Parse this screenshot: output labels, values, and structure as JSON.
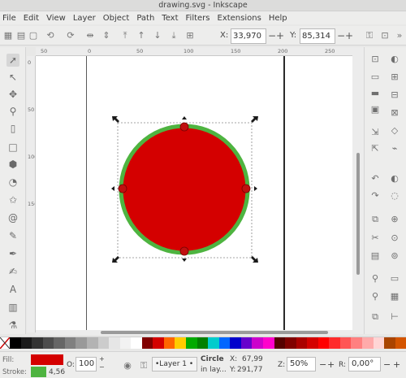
{
  "window": {
    "title": "drawing.svg - Inkscape"
  },
  "menu": [
    "File",
    "Edit",
    "View",
    "Layer",
    "Object",
    "Path",
    "Text",
    "Filters",
    "Extensions",
    "Help"
  ],
  "coords": {
    "x_label": "X:",
    "x_value": "33,970",
    "y_label": "Y:",
    "y_value": "85,314",
    "minus": "−",
    "plus": "+"
  },
  "ruler": {
    "h_ticks": [
      "50",
      "0",
      "50",
      "100",
      "150",
      "200",
      "250"
    ],
    "v_ticks": [
      "0",
      "50",
      "100",
      "150"
    ]
  },
  "tools": [
    "selector-tool",
    "node-tool",
    "tweak-tool",
    "zoom-tool",
    "measure-tool",
    "rectangle-tool",
    "box-tool",
    "ellipse-tool",
    "star-tool",
    "spiral-tool",
    "pencil-tool",
    "pen-tool",
    "calligraphy-tool",
    "text-tool",
    "gradient-tool",
    "dropper-tool"
  ],
  "colors": {
    "fill": "#d40000",
    "stroke": "#4eb440",
    "node": "#c01010",
    "palette": [
      "#000000",
      "#1a1a1a",
      "#333333",
      "#4d4d4d",
      "#666666",
      "#808080",
      "#999999",
      "#b3b3b3",
      "#cccccc",
      "#e6e6e6",
      "#f2f2f2",
      "#ffffff",
      "#800000",
      "#d40000",
      "#ff6600",
      "#ffcc00",
      "#00aa00",
      "#008000",
      "#00cccc",
      "#0066ff",
      "#0000cc",
      "#6600cc",
      "#cc00cc",
      "#ff00cc",
      "#550000",
      "#800000",
      "#aa0000",
      "#d40000",
      "#ff0000",
      "#ff2a2a",
      "#ff5555",
      "#ff8080",
      "#ffaaaa",
      "#ffd5d5",
      "#aa4400",
      "#d45500"
    ]
  },
  "status": {
    "fill_label": "Fill:",
    "stroke_label": "Stroke:",
    "stroke_width": "4,56",
    "opacity_label": "O:",
    "opacity_value": "100",
    "layer_value": "•Layer 1 •",
    "object_type": "Circle",
    "in_layer": "in lay...",
    "x_label": "X:",
    "x_value": "67,99",
    "y_label": "Y:",
    "y_value": "291,77",
    "zoom_label": "Z:",
    "zoom_value": "50%",
    "rotate_label": "R:",
    "rotate_value": "0,00°"
  }
}
